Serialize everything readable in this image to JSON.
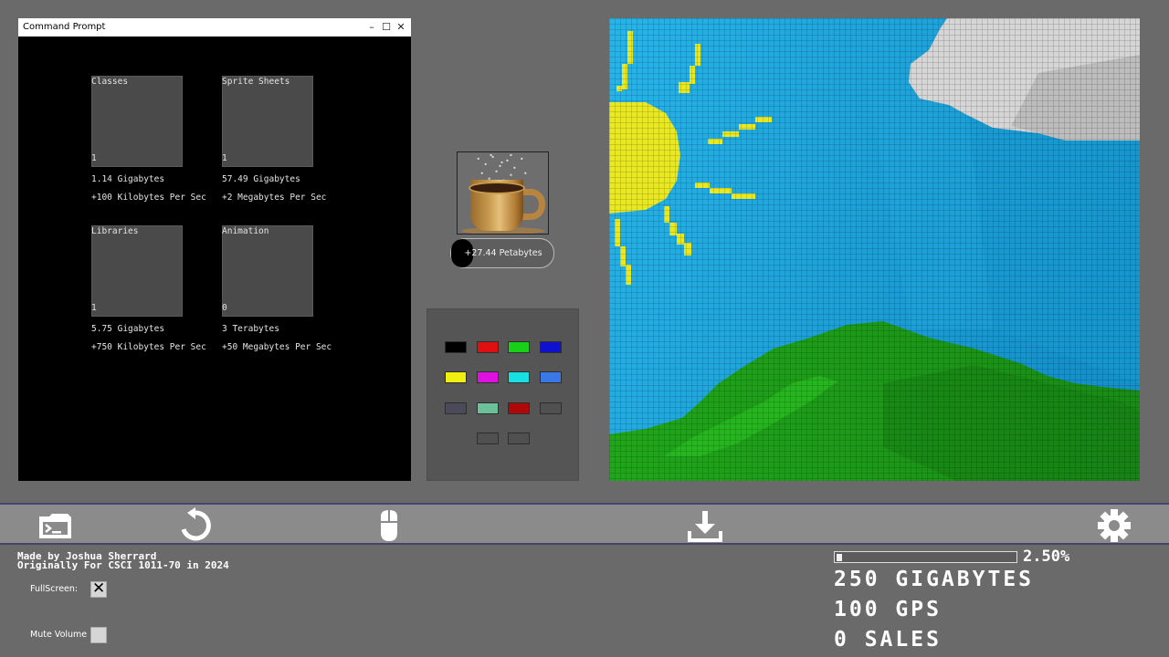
{
  "window": {
    "title": "Command Prompt",
    "minimize": "–",
    "maximize": "☐",
    "close": "✕"
  },
  "upgrades": [
    {
      "name": "Classes",
      "count": "1",
      "size": "1.14 Gigabytes",
      "rate": "+100 Kilobytes Per Sec"
    },
    {
      "name": "Sprite Sheets",
      "count": "1",
      "size": "57.49 Gigabytes",
      "rate": "+2 Megabytes Per Sec"
    },
    {
      "name": "Libraries",
      "count": "1",
      "size": "5.75 Gigabytes",
      "rate": "+750 Kilobytes Per Sec"
    },
    {
      "name": "Animation",
      "count": "0",
      "size": "3 Terabytes",
      "rate": "+50 Megabytes Per Sec"
    }
  ],
  "coffee": {
    "icon": "coffee-cup-icon",
    "boost_label": "+27.44 Petabytes"
  },
  "palette": {
    "colors": [
      "#000000",
      "#e01010",
      "#18d018",
      "#1010d0",
      "#f0f010",
      "#e010e0",
      "#18e0e0",
      "#3a78e8",
      "#4a4a5a",
      "#6cc09a",
      "#b00808",
      "#505050",
      "#505050",
      "#505050"
    ]
  },
  "toolbar": {
    "icons": [
      "terminal-icon",
      "reset-icon",
      "mouse-icon",
      "download-icon",
      "settings-icon"
    ]
  },
  "footer": {
    "credit_line1": "Made by Joshua Sherrard",
    "credit_line2": "Originally For CSCI 1011-70 in 2024",
    "fullscreen_label": "FullScreen:",
    "fullscreen_checked": true,
    "mute_label": "Mute Volume",
    "mute_checked": false
  },
  "stats": {
    "progress_fraction": 0.025,
    "progress_text": "2.50%",
    "storage": "250 GIGABYTES",
    "rate": "100 GPS",
    "sales": "0 SALES"
  }
}
